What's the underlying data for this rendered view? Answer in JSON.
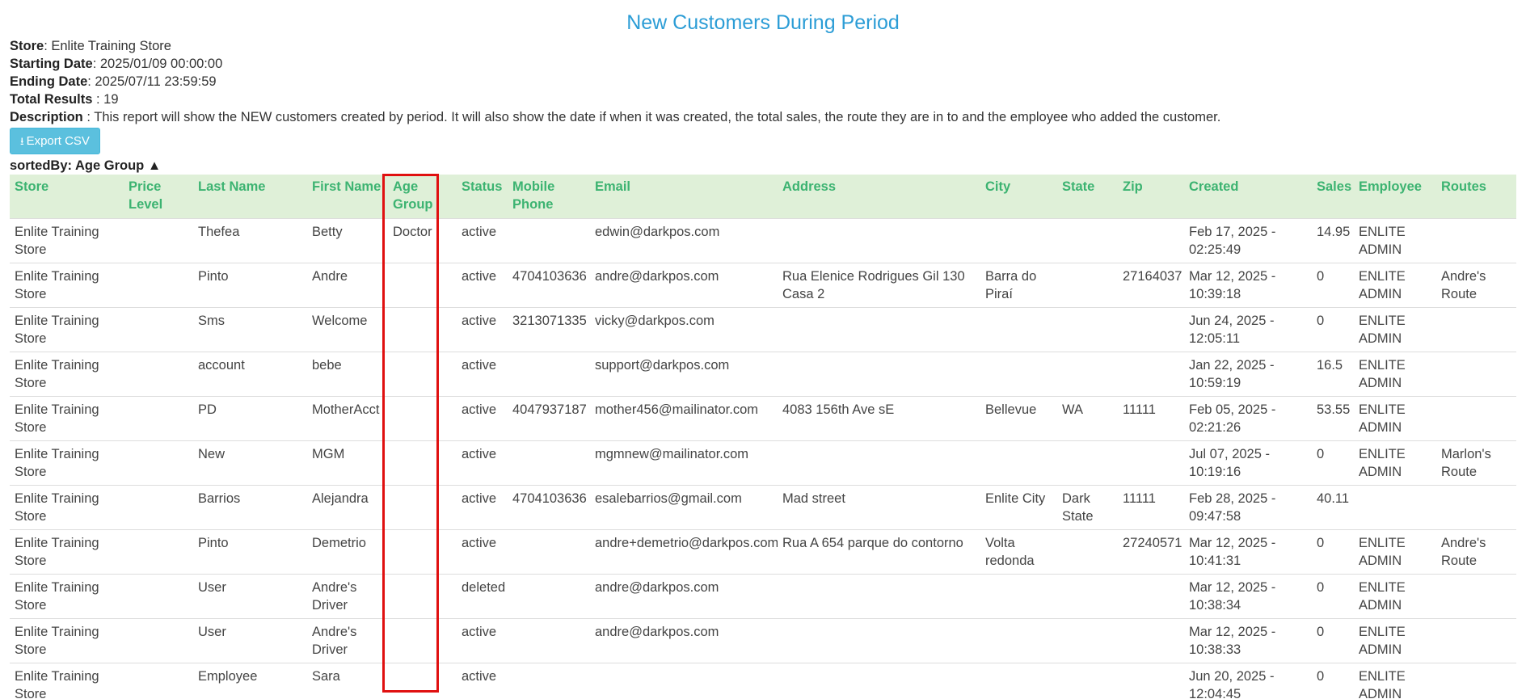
{
  "report": {
    "title": "New Customers During Period",
    "store_label": "Store",
    "store_value": ": Enlite Training Store",
    "start_label": "Starting Date",
    "start_value": ": 2025/01/09 00:00:00",
    "end_label": "Ending Date",
    "end_value": ": 2025/07/11 23:59:59",
    "total_label": "Total Results",
    "total_value": " : 19",
    "desc_label": "Description",
    "desc_value": " : This report will show the NEW customers created by period. It will also show the date if when it was created, the total sales, the route they are in to and the employee who added the customer.",
    "export_label": "Export CSV",
    "export_icon": "download-icon",
    "sorted_by": "sortedBy: Age Group ▲"
  },
  "columns": [
    "Store",
    "Price Level",
    "Last Name",
    "First Name",
    "Age Group",
    "Status",
    "Mobile Phone",
    "Email",
    "Address",
    "City",
    "State",
    "Zip",
    "Created",
    "Sales",
    "Employee",
    "Routes"
  ],
  "rows": [
    [
      "Enlite Training Store",
      "",
      "Thefea",
      "Betty",
      "Doctor",
      "active",
      "",
      "edwin@darkpos.com",
      "",
      "",
      "",
      "",
      "Feb 17, 2025 - 02:25:49",
      "14.95",
      "ENLITE ADMIN",
      ""
    ],
    [
      "Enlite Training Store",
      "",
      "Pinto",
      "Andre",
      "",
      "active",
      "4704103636",
      "andre@darkpos.com",
      "Rua Elenice Rodrigues Gil 130 Casa 2",
      "Barra do Piraí",
      "",
      "27164037",
      "Mar 12, 2025 - 10:39:18",
      "0",
      "ENLITE ADMIN",
      "Andre's Route"
    ],
    [
      "Enlite Training Store",
      "",
      "Sms",
      "Welcome",
      "",
      "active",
      "3213071335",
      "vicky@darkpos.com",
      "",
      "",
      "",
      "",
      "Jun 24, 2025 - 12:05:11",
      "0",
      "ENLITE ADMIN",
      ""
    ],
    [
      "Enlite Training Store",
      "",
      "account",
      "bebe",
      "",
      "active",
      "",
      "support@darkpos.com",
      "",
      "",
      "",
      "",
      "Jan 22, 2025 - 10:59:19",
      "16.5",
      "ENLITE ADMIN",
      ""
    ],
    [
      "Enlite Training Store",
      "",
      "PD",
      "MotherAcct",
      "",
      "active",
      "4047937187",
      "mother456@mailinator.com",
      "4083 156th Ave sE",
      "Bellevue",
      "WA",
      "11111",
      "Feb 05, 2025 - 02:21:26",
      "53.55",
      "ENLITE ADMIN",
      ""
    ],
    [
      "Enlite Training Store",
      "",
      "New",
      "MGM",
      "",
      "active",
      "",
      "mgmnew@mailinator.com",
      "",
      "",
      "",
      "",
      "Jul 07, 2025 - 10:19:16",
      "0",
      "ENLITE ADMIN",
      "Marlon's Route"
    ],
    [
      "Enlite Training Store",
      "",
      "Barrios",
      "Alejandra",
      "",
      "active",
      "4704103636",
      "esalebarrios@gmail.com",
      "Mad street",
      "Enlite City",
      "Dark State",
      "11111",
      "Feb 28, 2025 - 09:47:58",
      "40.11",
      "",
      ""
    ],
    [
      "Enlite Training Store",
      "",
      "Pinto",
      "Demetrio",
      "",
      "active",
      "",
      "andre+demetrio@darkpos.com",
      "Rua A 654 parque do contorno",
      "Volta redonda",
      "",
      "27240571",
      "Mar 12, 2025 - 10:41:31",
      "0",
      "ENLITE ADMIN",
      "Andre's Route"
    ],
    [
      "Enlite Training Store",
      "",
      "User",
      "Andre's Driver",
      "",
      "deleted",
      "",
      "andre@darkpos.com",
      "",
      "",
      "",
      "",
      "Mar 12, 2025 - 10:38:34",
      "0",
      "ENLITE ADMIN",
      ""
    ],
    [
      "Enlite Training Store",
      "",
      "User",
      "Andre's Driver",
      "",
      "active",
      "",
      "andre@darkpos.com",
      "",
      "",
      "",
      "",
      "Mar 12, 2025 - 10:38:33",
      "0",
      "ENLITE ADMIN",
      ""
    ],
    [
      "Enlite Training Store",
      "",
      "Employee",
      "Sara",
      "",
      "active",
      "",
      "",
      "",
      "",
      "",
      "",
      "Jun 20, 2025 - 12:04:45",
      "0",
      "ENLITE ADMIN",
      ""
    ]
  ],
  "annotation": {
    "color": "#e01010"
  },
  "colors": {
    "title": "#2c9dd6",
    "header_bg": "#dff0d8",
    "header_text": "#3cb371",
    "button": "#5bc0de"
  }
}
